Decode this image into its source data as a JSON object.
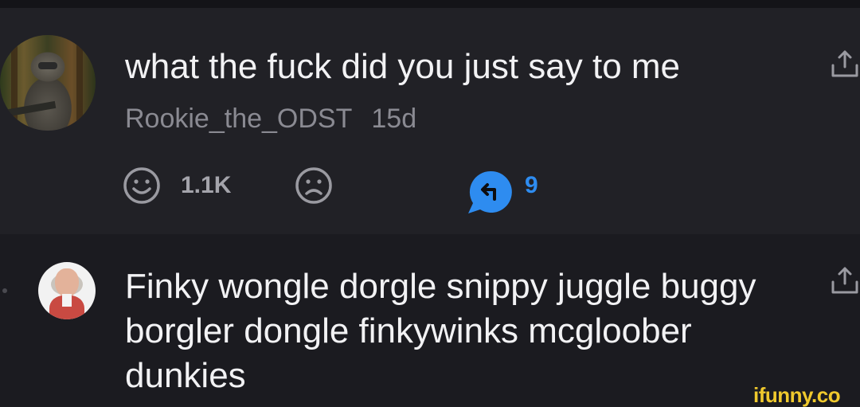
{
  "comment1": {
    "text": "what the fuck did you just say to me",
    "author": "Rookie_the_ODST",
    "time": "15d",
    "upvotes": "1.1K",
    "replies": "9"
  },
  "comment2": {
    "text": "Finky wongle dorgle snippy juggle buggy borgler dongle finkywinks mcgloober dunkies"
  },
  "watermark": "ifunny.co",
  "colors": {
    "background": "#1c1c21",
    "highlight": "#212126",
    "reply_accent": "#2e8cf0",
    "watermark": "#f0c92d"
  },
  "icons": [
    "avatar",
    "share-icon",
    "smile-icon",
    "frown-icon",
    "reply-icon"
  ]
}
